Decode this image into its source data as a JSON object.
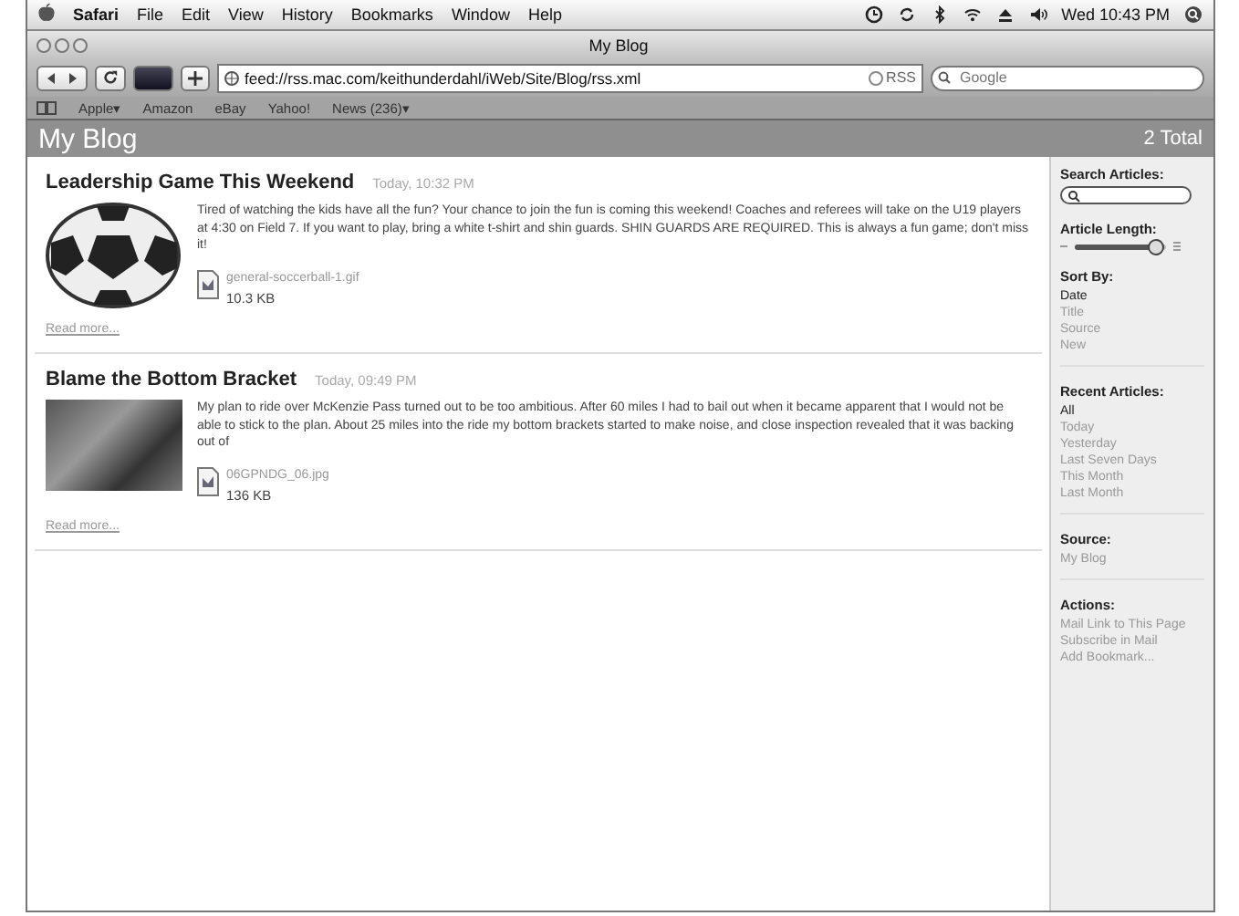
{
  "menu_bar": {
    "items": [
      "Safari",
      "File",
      "Edit",
      "View",
      "History",
      "Bookmarks",
      "Window",
      "Help"
    ],
    "clock": "Wed 10:43 PM"
  },
  "window": {
    "title": "My Blog"
  },
  "toolbar": {
    "address": "feed://rss.mac.com/keithunderdahl/iWeb/Site/Blog/rss.xml",
    "rss": "RSS",
    "search": {
      "placeholder": "Google"
    }
  },
  "bookmarks": [
    "Apple▾",
    "Amazon",
    "eBay",
    "Yahoo!",
    "News (236)▾"
  ],
  "header": {
    "title": "My Blog",
    "total": "2 Total"
  },
  "articles": [
    {
      "title": "Leadership Game This Weekend",
      "date": "Today, 10:32 PM",
      "body": "Tired of watching the kids have all the fun? Your chance to join the fun is coming this weekend! Coaches and referees will take on the U19 players at 4:30 on Field 7. If you want to play, bring a white t-shirt and shin guards. SHIN GUARDS ARE REQUIRED. This is always a fun game; don't miss it!",
      "file": "general-soccerball-1.gif",
      "size": "10.3 KB",
      "more": "Read more..."
    },
    {
      "title": "Blame the Bottom Bracket",
      "date": "Today, 09:49 PM",
      "body": "My plan to ride over McKenzie Pass turned out to be too ambitious. After 60 miles I had to bail out when it became apparent that I would not be able to stick to the plan. About 25 miles into the ride my bottom brackets started to make noise, and close inspection revealed that it was backing out of",
      "file": "06GPNDG_06.jpg",
      "size": "136 KB",
      "more": "Read more..."
    }
  ],
  "sidebar": {
    "search_label": "Search Articles:",
    "length_label": "Article Length:",
    "length": {
      "level": 0.88
    },
    "sort_label": "Sort By:",
    "sort": [
      {
        "label": "Date",
        "selected": true
      },
      {
        "label": "Title",
        "selected": false
      },
      {
        "label": "Source",
        "selected": false
      },
      {
        "label": "New",
        "selected": false
      }
    ],
    "recent_label": "Recent Articles:",
    "recent": [
      {
        "label": "All",
        "selected": true
      },
      {
        "label": "Today",
        "selected": false
      },
      {
        "label": "Yesterday",
        "selected": false
      },
      {
        "label": "Last Seven Days",
        "selected": false
      },
      {
        "label": "This Month",
        "selected": false
      },
      {
        "label": "Last Month",
        "selected": false
      }
    ],
    "source_label": "Source:",
    "source": "My Blog",
    "actions_label": "Actions:",
    "actions": [
      "Mail Link to This Page",
      "Subscribe in Mail",
      "Add Bookmark..."
    ]
  }
}
